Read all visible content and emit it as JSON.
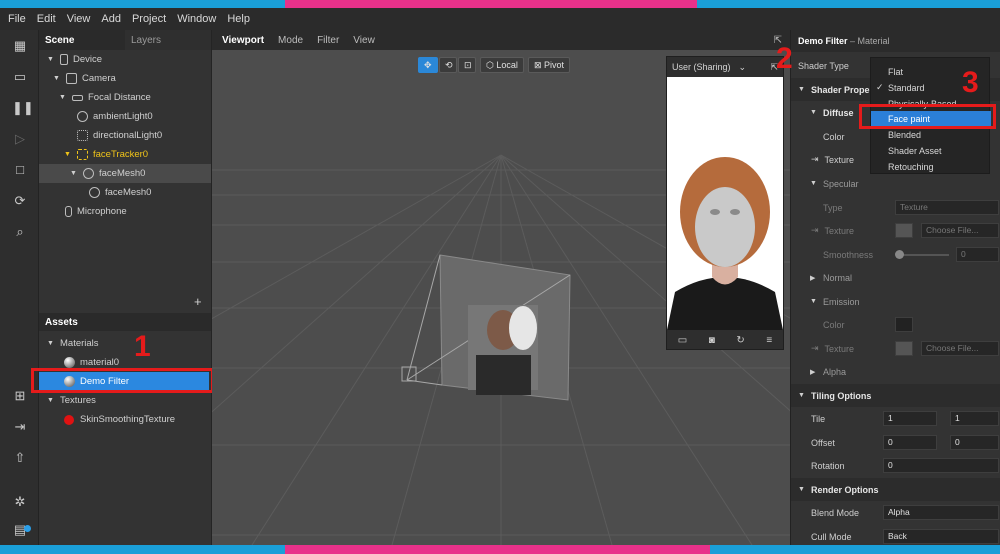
{
  "menubar": {
    "items": [
      "File",
      "Edit",
      "View",
      "Add",
      "Project",
      "Window",
      "Help"
    ]
  },
  "scene": {
    "tabs": [
      "Scene",
      "Layers"
    ],
    "tree": [
      {
        "label": "Device"
      },
      {
        "label": "Camera"
      },
      {
        "label": "Focal Distance"
      },
      {
        "label": "ambientLight0"
      },
      {
        "label": "directionalLight0"
      },
      {
        "label": "faceTracker0"
      },
      {
        "label": "faceMesh0"
      },
      {
        "label": "faceMesh0"
      },
      {
        "label": "Microphone"
      }
    ],
    "add_label": "+"
  },
  "assets": {
    "title": "Assets",
    "materials_label": "Materials",
    "material0": "material0",
    "demo_filter": "Demo Filter",
    "textures_label": "Textures",
    "texture0": "SkinSmoothingTexture"
  },
  "viewport": {
    "tabs": [
      "Viewport",
      "Mode",
      "Filter",
      "View"
    ],
    "tool_local": "Local",
    "tool_pivot": "Pivot"
  },
  "simulator": {
    "device": "User (Sharing)"
  },
  "inspector": {
    "title": "Demo Filter",
    "subtitle": "– Material",
    "shader_type_label": "Shader Type",
    "shader_properties": "Shader Propert",
    "diffuse": "Diffuse",
    "color": "Color",
    "texture": "Texture",
    "specular": "Specular",
    "type": "Type",
    "type_value": "Texture",
    "texture2": "Texture",
    "choose_file": "Choose File...",
    "smoothness": "Smoothness",
    "smoothness_value": "0",
    "normal": "Normal",
    "emission": "Emission",
    "emission_color": "Color",
    "emission_texture": "Texture",
    "choose_file2": "Choose File...",
    "alpha": "Alpha",
    "tiling_options": "Tiling Options",
    "tile": "Tile",
    "tile_values": [
      "1",
      "1"
    ],
    "offset": "Offset",
    "offset_values": [
      "0",
      "0"
    ],
    "rotation": "Rotation",
    "rotation_value": "0",
    "render_options": "Render Options",
    "blend_mode": "Blend Mode",
    "blend_mode_value": "Alpha",
    "cull_mode": "Cull Mode",
    "cull_mode_value": "Back"
  },
  "shader_menu": {
    "options": [
      "Flat",
      "Standard",
      "Physically-Based",
      "Face paint",
      "Blended",
      "Shader Asset",
      "Retouching"
    ],
    "checked": "Standard",
    "highlighted": "Face paint"
  },
  "annotations": {
    "n1": "1",
    "n2": "2",
    "n3": "3"
  },
  "colors": {
    "accent": "#2b7fd8",
    "annotation": "#e51b1b",
    "frame_blue": "#1a9fd8",
    "frame_pink": "#e8318a"
  }
}
